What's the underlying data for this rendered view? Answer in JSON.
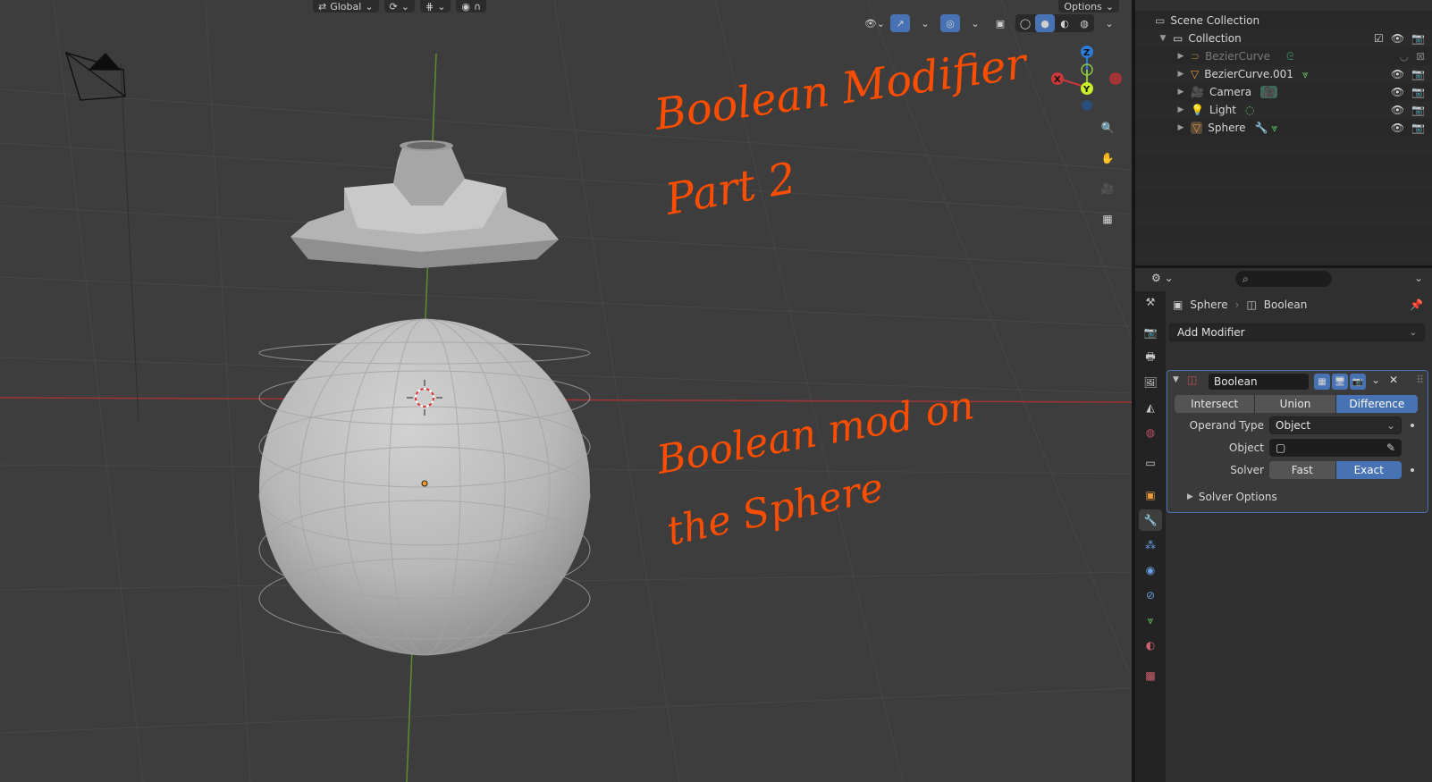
{
  "viewport": {
    "header": {
      "orientation": "Global",
      "options": "Options"
    },
    "annotations": {
      "line1": "Boolean Modifier",
      "line2": "Part 2",
      "line3": "Boolean mod on",
      "line4": "the Sphere",
      "color": "#ff4d00"
    },
    "gizmo": {
      "z": "Z",
      "y": "Y",
      "x": "X"
    }
  },
  "outliner": {
    "rows": [
      {
        "label": "Scene Collection"
      },
      {
        "label": "Collection"
      },
      {
        "label": "BezierCurve"
      },
      {
        "label": "BezierCurve.001"
      },
      {
        "label": "Camera"
      },
      {
        "label": "Light"
      },
      {
        "label": "Sphere"
      }
    ]
  },
  "properties": {
    "breadcrumb": {
      "object": "Sphere",
      "modifier": "Boolean"
    },
    "add_modifier": "Add Modifier",
    "modifier": {
      "name": "Boolean",
      "operations": [
        "Intersect",
        "Union",
        "Difference"
      ],
      "active_operation": "Difference",
      "operand_type_label": "Operand Type",
      "operand_type_value": "Object",
      "object_label": "Object",
      "solver_label": "Solver",
      "solvers": [
        "Fast",
        "Exact"
      ],
      "active_solver": "Exact",
      "solver_options": "Solver Options"
    }
  },
  "colors": {
    "accent": "#4772b3",
    "annotation": "#ff4d00",
    "x_axis": "#c8383a",
    "y_axis": "#8cc63f",
    "z_axis": "#2b7bd8"
  }
}
